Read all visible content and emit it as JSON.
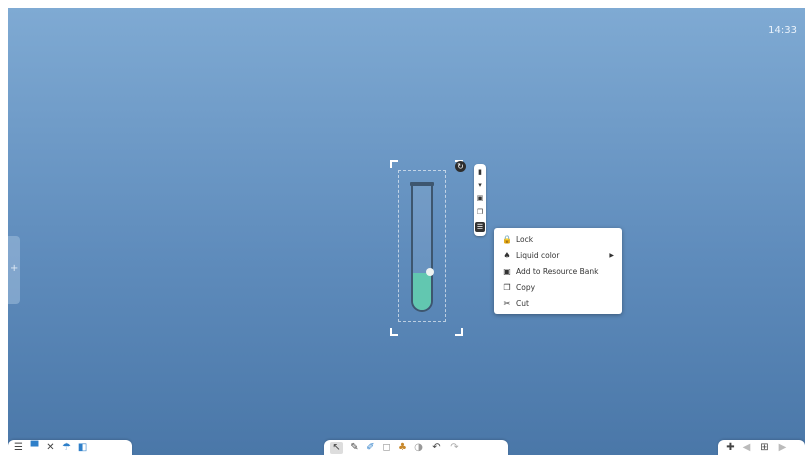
{
  "clock": "14:33",
  "side_tab": {
    "icon": "+"
  },
  "test_tube": {
    "liquid_color": "#62c7b0",
    "liquid_level": 0.3
  },
  "object_toolbar": {
    "rotate_icon": "↻",
    "icons": [
      "lock-icon",
      "liquid-color-icon",
      "resource-bank-icon",
      "copy-icon",
      "menu-icon"
    ]
  },
  "context_menu": {
    "items": [
      {
        "label": "Lock",
        "icon": "lock-icon",
        "glyph": "🔒"
      },
      {
        "label": "Liquid color",
        "icon": "liquid-color-icon",
        "glyph": "♠",
        "submenu": true
      },
      {
        "label": "Add to Resource Bank",
        "icon": "resource-bank-icon",
        "glyph": "▣"
      },
      {
        "label": "Copy",
        "icon": "copy-icon",
        "glyph": "❐"
      },
      {
        "label": "Cut",
        "icon": "scissors-icon",
        "glyph": "✂"
      }
    ]
  },
  "toolbars": {
    "left": [
      "☰",
      "▀",
      "✕",
      "☂",
      "◧"
    ],
    "middle": [
      "↖",
      "✎",
      "✐",
      "◻",
      "♣",
      "◑",
      "↶",
      "↷"
    ],
    "right": [
      "✚",
      "◀",
      "⊞",
      "▶"
    ]
  }
}
